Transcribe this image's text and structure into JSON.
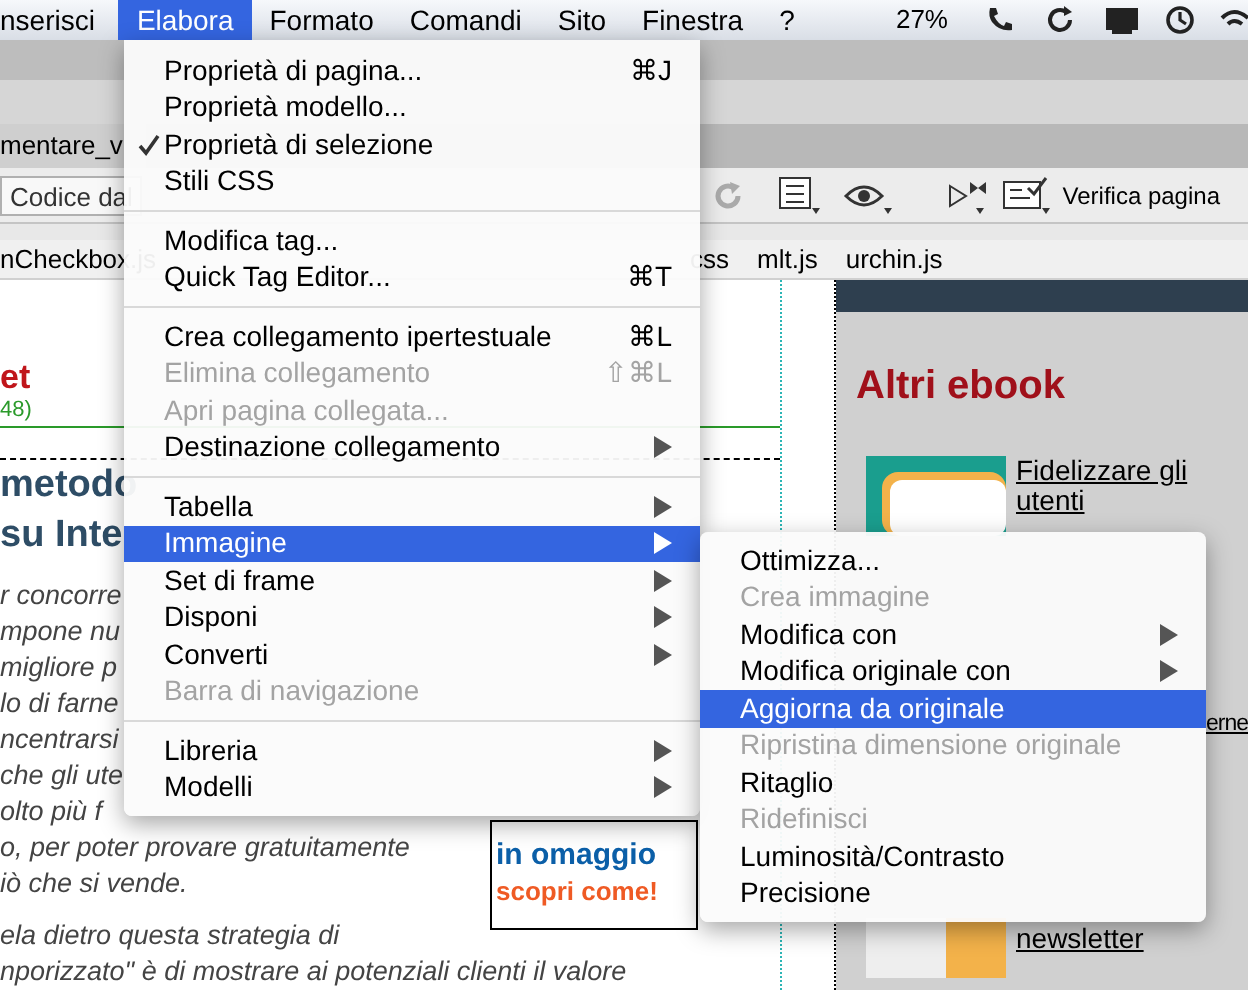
{
  "menu_bar": {
    "items": [
      {
        "label": "nserisci",
        "selected": false
      },
      {
        "label": "Elabora",
        "selected": true
      },
      {
        "label": "Formato",
        "selected": false
      },
      {
        "label": "Comandi",
        "selected": false
      },
      {
        "label": "Sito",
        "selected": false
      },
      {
        "label": "Finestra",
        "selected": false
      },
      {
        "label": "?",
        "selected": false
      }
    ],
    "battery": "27%"
  },
  "document_tab": {
    "title": "mentare_v"
  },
  "toolbar": {
    "code_button": "Codice dal",
    "check_page": "Verifica pagina"
  },
  "file_tabs": [
    "nCheckbox.js",
    "css",
    "mlt.js",
    "urchin.js"
  ],
  "design_view": {
    "logo_fragment": "et",
    "counter": "48)",
    "heading_lines": [
      "metodo",
      "su Inte"
    ],
    "article_lines": [
      "r concorre",
      "mpone nu",
      "migliore p",
      "lo di farne",
      "ncentrarsi",
      "che gli ute",
      "olto più f",
      "o, per poter provare gratuitamente",
      "iò che si vende.",
      "ela dietro questa strategia di",
      "nporizzato\" è di mostrare ai potenziali clienti il valore"
    ],
    "banner": [
      "in omaggio",
      "scopri come!"
    ]
  },
  "side_panel": {
    "title": "Altri ebook",
    "links": [
      "Fidelizzare gli utenti",
      "erne",
      "newsletter"
    ]
  },
  "menu": {
    "items": [
      {
        "kind": "item",
        "label": "Proprietà di pagina...",
        "shortcut": "⌘J",
        "checked": false,
        "disabled": false,
        "submenu": false,
        "selected": false
      },
      {
        "kind": "item",
        "label": "Proprietà modello...",
        "checked": false,
        "disabled": false,
        "submenu": false,
        "selected": false
      },
      {
        "kind": "item",
        "label": "Proprietà di selezione",
        "checked": true,
        "disabled": false,
        "submenu": false,
        "selected": false
      },
      {
        "kind": "item",
        "label": "Stili CSS",
        "checked": false,
        "disabled": false,
        "submenu": false,
        "selected": false
      },
      {
        "kind": "separator"
      },
      {
        "kind": "item",
        "label": "Modifica tag...",
        "checked": false,
        "disabled": false,
        "submenu": false,
        "selected": false
      },
      {
        "kind": "item",
        "label": "Quick Tag Editor...",
        "shortcut": "⌘T",
        "checked": false,
        "disabled": false,
        "submenu": false,
        "selected": false
      },
      {
        "kind": "separator"
      },
      {
        "kind": "item",
        "label": "Crea collegamento ipertestuale",
        "shortcut": "⌘L",
        "checked": false,
        "disabled": false,
        "submenu": false,
        "selected": false
      },
      {
        "kind": "item",
        "label": "Elimina collegamento",
        "shortcut": "⇧⌘L",
        "checked": false,
        "disabled": true,
        "submenu": false,
        "selected": false
      },
      {
        "kind": "item",
        "label": "Apri pagina collegata...",
        "checked": false,
        "disabled": true,
        "submenu": false,
        "selected": false
      },
      {
        "kind": "item",
        "label": "Destinazione collegamento",
        "checked": false,
        "disabled": false,
        "submenu": true,
        "selected": false
      },
      {
        "kind": "separator"
      },
      {
        "kind": "item",
        "label": "Tabella",
        "checked": false,
        "disabled": false,
        "submenu": true,
        "selected": false
      },
      {
        "kind": "item",
        "label": "Immagine",
        "checked": false,
        "disabled": false,
        "submenu": true,
        "selected": true
      },
      {
        "kind": "item",
        "label": "Set di frame",
        "checked": false,
        "disabled": false,
        "submenu": true,
        "selected": false
      },
      {
        "kind": "item",
        "label": "Disponi",
        "checked": false,
        "disabled": false,
        "submenu": true,
        "selected": false
      },
      {
        "kind": "item",
        "label": "Converti",
        "checked": false,
        "disabled": false,
        "submenu": true,
        "selected": false
      },
      {
        "kind": "item",
        "label": "Barra di navigazione",
        "checked": false,
        "disabled": true,
        "submenu": false,
        "selected": false
      },
      {
        "kind": "separator"
      },
      {
        "kind": "item",
        "label": "Libreria",
        "checked": false,
        "disabled": false,
        "submenu": true,
        "selected": false
      },
      {
        "kind": "item",
        "label": "Modelli",
        "checked": false,
        "disabled": false,
        "submenu": true,
        "selected": false
      }
    ]
  },
  "submenu": {
    "items": [
      {
        "kind": "item",
        "label": "Ottimizza...",
        "disabled": false,
        "submenu": false,
        "selected": false
      },
      {
        "kind": "item",
        "label": "Crea immagine",
        "disabled": true,
        "submenu": false,
        "selected": false
      },
      {
        "kind": "item",
        "label": "Modifica con",
        "disabled": false,
        "submenu": true,
        "selected": false
      },
      {
        "kind": "item",
        "label": "Modifica originale con",
        "disabled": false,
        "submenu": true,
        "selected": false
      },
      {
        "kind": "item",
        "label": "Aggiorna da originale",
        "disabled": false,
        "submenu": false,
        "selected": true
      },
      {
        "kind": "item",
        "label": "Ripristina dimensione originale",
        "disabled": true,
        "submenu": false,
        "selected": false
      },
      {
        "kind": "item",
        "label": "Ritaglio",
        "disabled": false,
        "submenu": false,
        "selected": false
      },
      {
        "kind": "item",
        "label": "Ridefinisci",
        "disabled": true,
        "submenu": false,
        "selected": false
      },
      {
        "kind": "item",
        "label": "Luminosità/Contrasto",
        "disabled": false,
        "submenu": false,
        "selected": false
      },
      {
        "kind": "item",
        "label": "Precisione",
        "disabled": false,
        "submenu": false,
        "selected": false
      }
    ]
  }
}
